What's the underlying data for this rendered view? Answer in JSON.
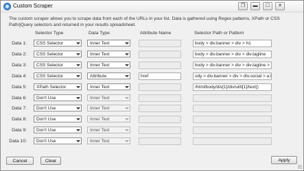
{
  "window": {
    "title": "Custom Scraper"
  },
  "description": "The custom scraper allows you to scrape data from each of the URLs in your list. Data is gathered using Regex patterns, XPath or CSS Path/jQuery selectors and returned in your results spreadsheet.",
  "headers": {
    "selector_type": "Selector Type",
    "data_type": "Data Type",
    "attribute_name": "Attribute Name",
    "selector_path": "Selector Path or Pattern"
  },
  "rows": [
    {
      "label": "Data 1:",
      "selector_type": "CSS Selector",
      "data_type": "Inner Text",
      "attribute": "",
      "path": "body > div.banner > div > h1",
      "enabled": true
    },
    {
      "label": "Data 2:",
      "selector_type": "CSS Selector",
      "data_type": "Inner Text",
      "attribute": "",
      "path": "body > div.banner > div > div.tagline",
      "enabled": true
    },
    {
      "label": "Data 3:",
      "selector_type": "CSS Selector",
      "data_type": "Inner Text",
      "attribute": "",
      "path": "body > div.banner > div > div.tagline > a",
      "enabled": true
    },
    {
      "label": "Data 4:",
      "selector_type": "CSS Selector",
      "data_type": "Attribute",
      "attribute": "href",
      "path": "ody > div.banner > div > div.social > a.fast",
      "enabled": true
    },
    {
      "label": "Data 5:",
      "selector_type": "XPath Selector",
      "data_type": "Inner Text",
      "attribute": "",
      "path": "/html/body/div[1]/div/ul/li[1]/text()",
      "enabled": true
    },
    {
      "label": "Data 6:",
      "selector_type": "Don't Use",
      "data_type": "Inner Text",
      "attribute": "",
      "path": "",
      "enabled": false
    },
    {
      "label": "Data 7:",
      "selector_type": "Don't Use",
      "data_type": "Inner Text",
      "attribute": "",
      "path": "",
      "enabled": false
    },
    {
      "label": "Data 8:",
      "selector_type": "Don't Use",
      "data_type": "Inner Text",
      "attribute": "",
      "path": "",
      "enabled": false
    },
    {
      "label": "Data 9:",
      "selector_type": "Don't Use",
      "data_type": "Inner Text",
      "attribute": "",
      "path": "",
      "enabled": false
    },
    {
      "label": "Data 10:",
      "selector_type": "Don't Use",
      "data_type": "Inner Text",
      "attribute": "",
      "path": "",
      "enabled": false
    }
  ],
  "buttons": {
    "cancel": "Cancel",
    "clear": "Clear",
    "apply": "Apply"
  }
}
